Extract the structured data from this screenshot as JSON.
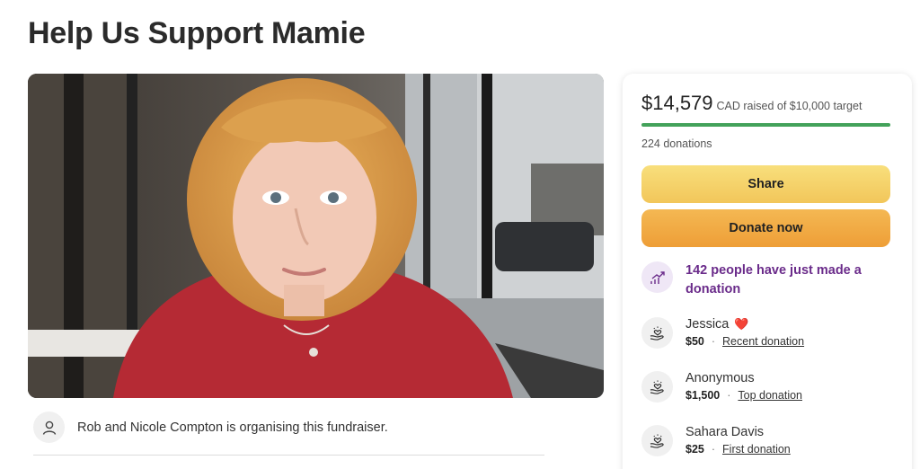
{
  "campaign": {
    "title": "Help Us Support Mamie"
  },
  "organiser": {
    "text": "Rob and Nicole Compton is organising this fundraiser."
  },
  "summary": {
    "amount": "$14,579",
    "raised_text": "CAD raised of $10,000 target",
    "progress_fraction": 1.0,
    "progress_color": "#43a25a",
    "donations_count": "224 donations"
  },
  "buttons": {
    "share": "Share",
    "donate": "Donate now"
  },
  "trend": {
    "icon": "trending-up-icon",
    "text": "142 people have just made a donation"
  },
  "donors": [
    {
      "name": "Jessica",
      "heart": "❤️",
      "amount": "$50",
      "sep": "·",
      "tag": "Recent donation"
    },
    {
      "name": "Anonymous",
      "heart": "",
      "amount": "$1,500",
      "sep": "·",
      "tag": "Top donation"
    },
    {
      "name": "Sahara Davis",
      "heart": "",
      "amount": "$25",
      "sep": "·",
      "tag": "First donation"
    }
  ],
  "colors": {
    "accent_purple": "#6a2b8a",
    "share_yellow": "#f2c65a",
    "donate_orange": "#ee9e37"
  }
}
